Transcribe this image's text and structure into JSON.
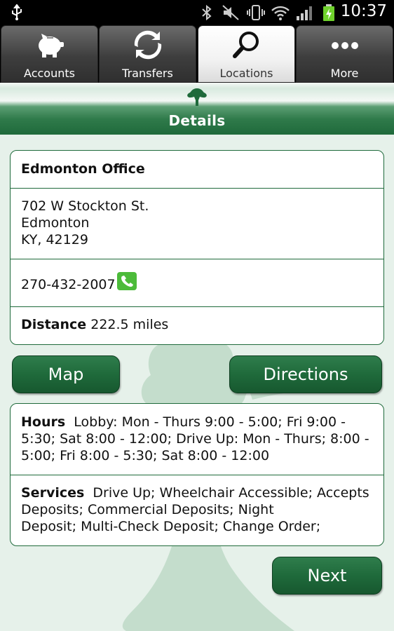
{
  "status_bar": {
    "time": "10:37",
    "icons": [
      "usb-icon",
      "bluetooth-icon",
      "mute-icon",
      "vibrate-icon",
      "wifi-icon",
      "signal-icon",
      "battery-charging-icon"
    ]
  },
  "tabs": [
    {
      "label": "Accounts",
      "icon": "piggy-bank-icon",
      "active": false
    },
    {
      "label": "Transfers",
      "icon": "transfer-arrows-icon",
      "active": false
    },
    {
      "label": "Locations",
      "icon": "magnifier-icon",
      "active": true
    },
    {
      "label": "More",
      "icon": "more-dots-icon",
      "active": false
    }
  ],
  "header": {
    "title": "Details"
  },
  "location": {
    "name": "Edmonton Office",
    "address_line1": "702 W Stockton St.",
    "address_line2": "Edmonton",
    "address_line3": "KY, 42129",
    "phone": "270-432-2007",
    "distance_label": "Distance",
    "distance_value": "222.5 miles"
  },
  "buttons": {
    "map": "Map",
    "directions": "Directions",
    "next": "Next"
  },
  "details": {
    "hours_label": "Hours",
    "hours_line1": "Lobby: Mon - Thurs 9:00 - 5:00; Fri 9:00 -",
    "hours_line2": "5:30; Sat 8:00 - 12:00; Drive Up: Mon - Thurs; 8:00 -",
    "hours_line3": "5:00; Fri 8:00 - 5:30; Sat 8:00 - 12:00",
    "services_label": "Services",
    "services_line1": "Drive Up; Wheelchair Accessible; Accepts",
    "services_line2": "Deposits; Commercial Deposits; Night",
    "services_line3": "Deposit; Multi-Check Deposit; Change Order;"
  },
  "colors": {
    "brand_green": "#1f6a3b",
    "background": "#e6f1ea",
    "phone_green": "#4cbb3a"
  }
}
